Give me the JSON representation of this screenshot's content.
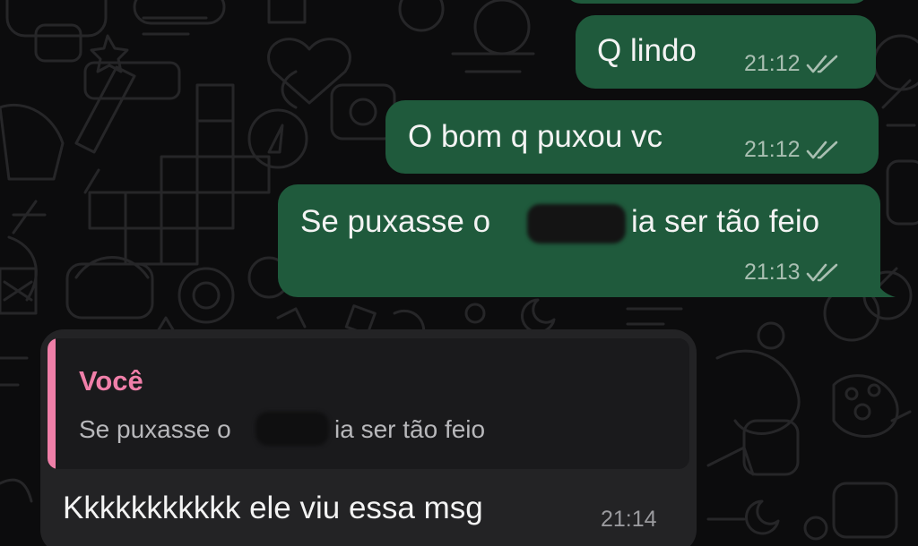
{
  "colors": {
    "background": "#0c0c0d",
    "outgoing_bubble": "#1f5a3c",
    "incoming_bubble": "#232325",
    "quote_accent": "#ef7fa8",
    "meta_text": "#a9bfb2"
  },
  "messages": [
    {
      "direction": "outgoing",
      "text": "Q lindo",
      "time": "21:12",
      "status_icon": "double-check-icon"
    },
    {
      "direction": "outgoing",
      "text": "O bom q puxou vc",
      "time": "21:12",
      "status_icon": "double-check-icon"
    },
    {
      "direction": "outgoing",
      "text_before": "Se puxasse o",
      "text_after": "ia ser tão feio",
      "redacted": true,
      "time": "21:13",
      "status_icon": "double-check-icon"
    },
    {
      "direction": "incoming",
      "quote": {
        "author": "Você",
        "text_before": "Se puxasse o",
        "text_after": "ia ser tão feio"
      },
      "text": "Kkkkkkkkkkk ele viu essa msg",
      "time": "21:14"
    }
  ]
}
